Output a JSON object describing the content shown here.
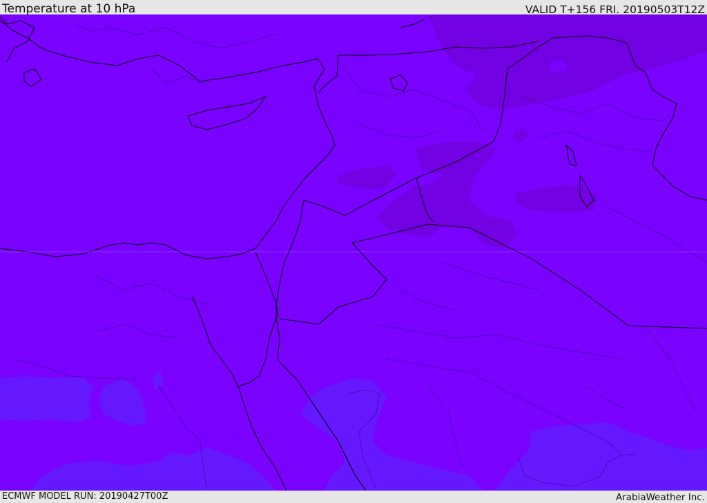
{
  "header": {
    "title": "Temperature at 10 hPa",
    "valid": "VALID T+156 FRI. 20190503T12Z"
  },
  "footer": {
    "model_run": "ECMWF MODEL RUN: 20190427T00Z",
    "credit": "ArabiaWeather Inc."
  },
  "colors": {
    "background_field": "#7a00ff",
    "cold_patch": "#7200e0",
    "warm_patch": "#6418ff",
    "border": "#000000"
  }
}
